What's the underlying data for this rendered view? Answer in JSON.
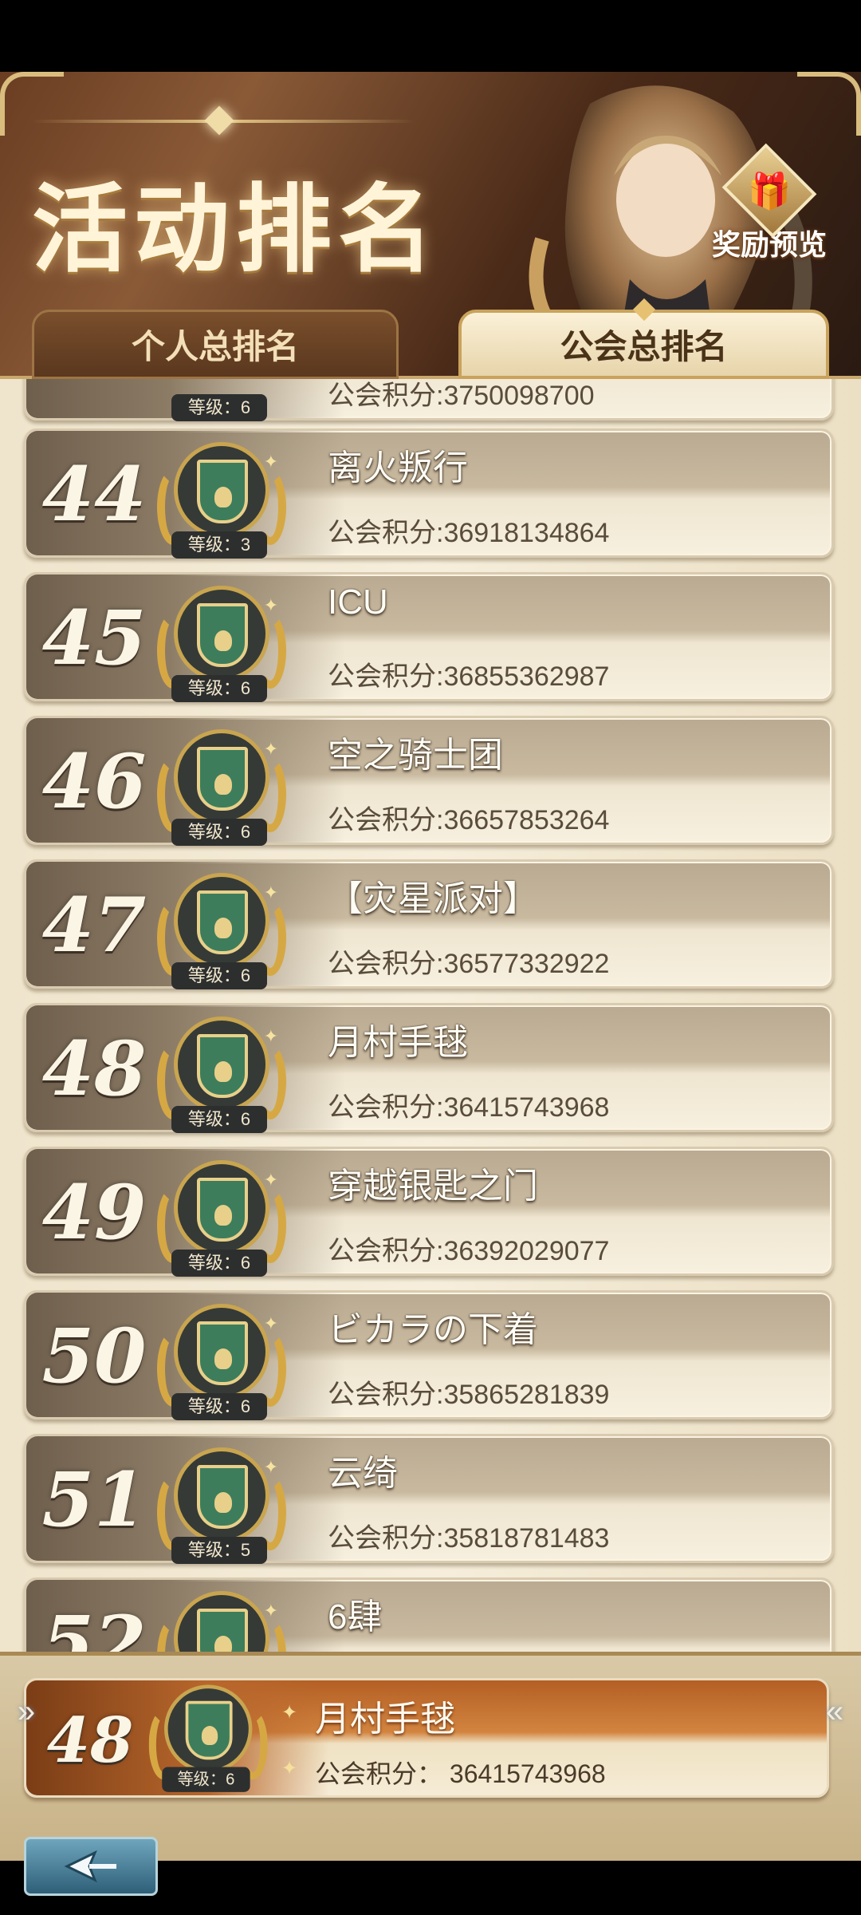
{
  "header": {
    "title": "活动排名",
    "reward_label": "奖励预览",
    "tabs": [
      {
        "label": "个人总排名",
        "active": false
      },
      {
        "label": "公会总排名",
        "active": true
      }
    ]
  },
  "score_prefix": "公会积分:",
  "list": [
    {
      "rank": "44",
      "name": "离火叛行",
      "level": "等级：3",
      "score": "36918134864"
    },
    {
      "rank": "45",
      "name": "ICU",
      "level": "等级：6",
      "score": "36855362987"
    },
    {
      "rank": "46",
      "name": "空之骑士团",
      "level": "等级：6",
      "score": "36657853264"
    },
    {
      "rank": "47",
      "name": "【灾星派对】",
      "level": "等级：6",
      "score": "36577332922"
    },
    {
      "rank": "48",
      "name": "月村手毬",
      "level": "等级：6",
      "score": "36415743968"
    },
    {
      "rank": "49",
      "name": "穿越银匙之门",
      "level": "等级：6",
      "score": "36392029077"
    },
    {
      "rank": "50",
      "name": "ビカラの下着",
      "level": "等级：6",
      "score": "35865281839"
    },
    {
      "rank": "51",
      "name": "云绮",
      "level": "等级：5",
      "score": "35818781483"
    },
    {
      "rank": "52",
      "name": "6肆",
      "level": "",
      "score": ""
    }
  ],
  "partial_top_row": {
    "level": "等级：6",
    "score_fragment": "公会积分:3750098700"
  },
  "own": {
    "rank": "48",
    "name": "月村手毬",
    "level": "等级：6",
    "score_label": "公会积分：",
    "score": "36415743968"
  },
  "icons": {
    "reward": "gift-icon",
    "back": "back-arrow-icon",
    "guild_emblem": "guild-shield-icon"
  },
  "colors": {
    "accent_gold": "#d6a844",
    "own_row": "#c0702f",
    "emblem_green": "#3d7d5c"
  }
}
